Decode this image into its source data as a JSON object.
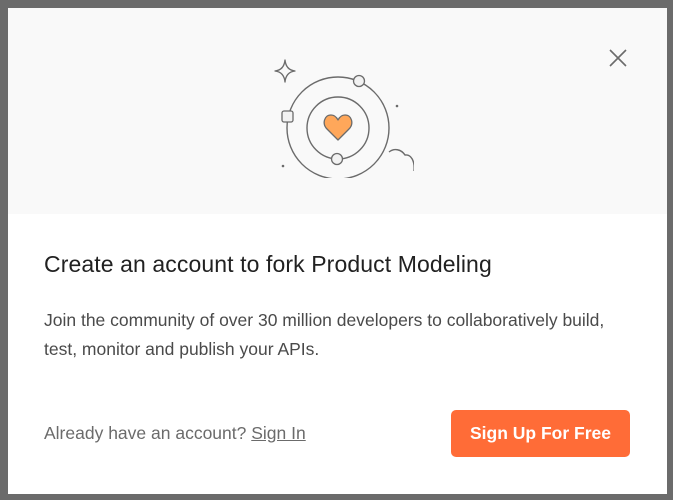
{
  "modal": {
    "title": "Create an account to fork Product Modeling",
    "description": "Join the community of over 30 million developers to collaboratively build, test, monitor and publish your APIs.",
    "footer": {
      "prompt": "Already have an account?",
      "signin_label": "Sign In"
    },
    "signup_label": "Sign Up For Free",
    "close_icon": "close-icon",
    "illustration_icon": "orbit-heart-icon"
  },
  "colors": {
    "accent": "#ff6c37",
    "heart": "#ffa75a",
    "hero_bg": "#f9f9f9",
    "backdrop": "#6b6b6b"
  }
}
